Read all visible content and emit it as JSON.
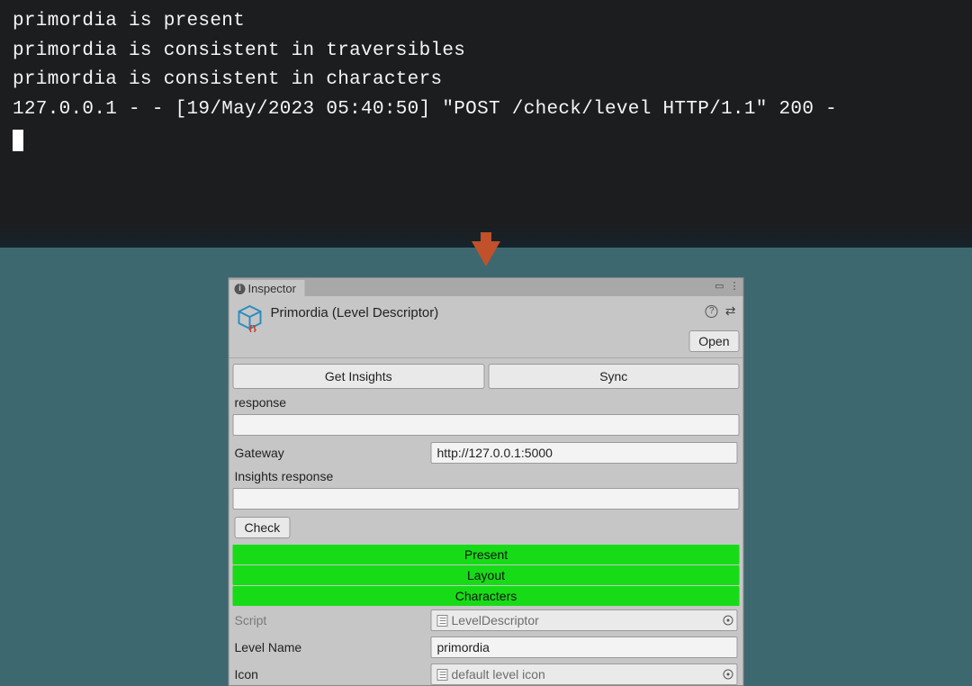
{
  "terminal": {
    "lines": [
      "primordia is present",
      "primordia is consistent in traversibles",
      "primordia is consistent in characters",
      "127.0.0.1 - - [19/May/2023 05:40:50] \"POST /check/level HTTP/1.1\" 200 -"
    ]
  },
  "inspector": {
    "tab_label": "Inspector",
    "title": "Primordia (Level Descriptor)",
    "open_label": "Open",
    "get_insights_label": "Get Insights",
    "sync_label": "Sync",
    "response_label": "response",
    "response_value": "",
    "gateway_label": "Gateway",
    "gateway_value": "http://127.0.0.1:5000",
    "insights_response_label": "Insights response",
    "insights_response_value": "",
    "check_label": "Check",
    "status": [
      "Present",
      "Layout",
      "Characters"
    ],
    "script_label": "Script",
    "script_value": "LevelDescriptor",
    "level_name_label": "Level Name",
    "level_name_value": "primordia",
    "icon_label": "Icon",
    "icon_value": "default level icon"
  }
}
